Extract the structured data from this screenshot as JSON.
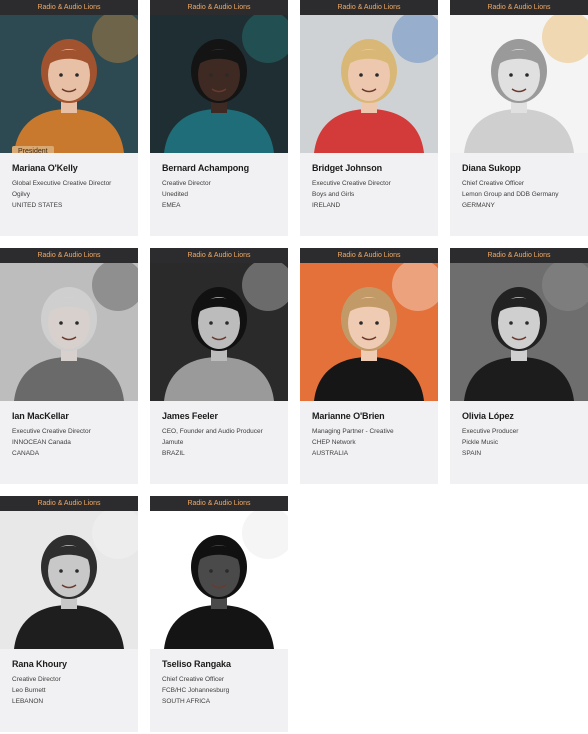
{
  "jury": [
    {
      "category": "Radio & Audio Lions",
      "name": "Mariana O'Kelly",
      "title": "Global Executive Creative Director",
      "company": "Ogilvy",
      "country": "UNITED STATES",
      "badge": "President",
      "bg": "#2d4a52",
      "skin": "#e8c0a5",
      "shirt": "#c9792e",
      "hair": "#a0532e",
      "accent": "#e8953a"
    },
    {
      "category": "Radio & Audio Lions",
      "name": "Bernard Achampong",
      "title": "Creative Director",
      "company": "Unedited",
      "country": "EMEA",
      "badge": "",
      "bg": "#1e2e33",
      "skin": "#3e2a22",
      "shirt": "#1f6d78",
      "hair": "#141414",
      "accent": "#2b8d8a"
    },
    {
      "category": "Radio & Audio Lions",
      "name": "Bridget Johnson",
      "title": "Executive Creative Director",
      "company": "Boys and Girls",
      "country": "IRELAND",
      "badge": "",
      "bg": "#cfd2d4",
      "skin": "#edc8ae",
      "shirt": "#d33a3a",
      "hair": "#d9b877",
      "accent": "#2f6cc0"
    },
    {
      "category": "Radio & Audio Lions",
      "name": "Diana Sukopp",
      "title": "Chief Creative Officer",
      "company": "Lemon Group and DDB Germany",
      "country": "GERMANY",
      "badge": "",
      "bg": "#f4f4f4",
      "skin": "#e0e0e0",
      "shirt": "#cfcfcf",
      "hair": "#9a9a9a",
      "accent": "#e8a43a"
    },
    {
      "category": "Radio & Audio Lions",
      "name": "Ian MacKellar",
      "title": "Executive Creative Director",
      "company": "INNOCEAN Canada",
      "country": "CANADA",
      "badge": "",
      "bg": "#bdbdbd",
      "skin": "#d8d0cc",
      "shirt": "#6a6a6a",
      "hair": "#cfcfcf",
      "accent": "#3a3a3a"
    },
    {
      "category": "Radio & Audio Lions",
      "name": "James Feeler",
      "title": "CEO, Founder and Audio Producer",
      "company": "Jamute",
      "country": "BRAZIL",
      "badge": "",
      "bg": "#2a2a2a",
      "skin": "#bcbcbc",
      "shirt": "#9a9a9a",
      "hair": "#111111",
      "accent": "#e6e6e6"
    },
    {
      "category": "Radio & Audio Lions",
      "name": "Marianne O'Brien",
      "title": "Managing Partner - Creative",
      "company": "CHEP Network",
      "country": "AUSTRALIA",
      "badge": "",
      "bg": "#e4703a",
      "skin": "#f0cbb3",
      "shirt": "#161616",
      "hair": "#c29a68",
      "accent": "#ffffff"
    },
    {
      "category": "Radio & Audio Lions",
      "name": "Olivia López",
      "title": "Executive Producer",
      "company": "Pickle Music",
      "country": "SPAIN",
      "badge": "",
      "bg": "#6e6e6e",
      "skin": "#cfcfcf",
      "shirt": "#1c1c1c",
      "hair": "#222222",
      "accent": "#9c9c9c"
    },
    {
      "category": "Radio & Audio Lions",
      "name": "Rana Khoury",
      "title": "Creative Director",
      "company": "Leo Burnett",
      "country": "LEBANON",
      "badge": "",
      "bg": "#e8e8e8",
      "skin": "#c8c8c8",
      "shirt": "#1e1e1e",
      "hair": "#2e2e2e",
      "accent": "#f6f6f6"
    },
    {
      "category": "Radio & Audio Lions",
      "name": "Tseliso Rangaka",
      "title": "Chief Creative Officer",
      "company": "FCB/HC Johannesburg",
      "country": "SOUTH AFRICA",
      "badge": "",
      "bg": "#ffffff",
      "skin": "#4a4a4a",
      "shirt": "#141414",
      "hair": "#111111",
      "accent": "#e2e2e2"
    }
  ]
}
